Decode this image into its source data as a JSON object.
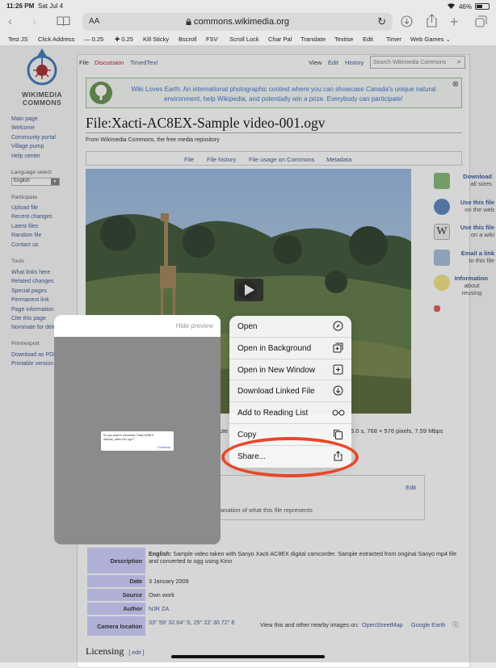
{
  "status": {
    "time": "11:26 PM",
    "date": "Sat Jul 4",
    "battery": "46%"
  },
  "browser": {
    "aa_label": "AA",
    "url": "commons.wikimedia.org",
    "bookmarks": [
      "Test JS",
      "Click Address",
      "— 0.25",
      "✚ 0.25",
      "Kill Sticky",
      "Bscroll",
      "FSV",
      "Scroll Lock",
      "Char Pal",
      "Translate",
      "Textise",
      "Edit",
      "Timer",
      "Web Games ⌄"
    ]
  },
  "wiki": {
    "logo_line1": "WIKIMEDIA",
    "logo_line2": "COMMONS",
    "nav": [
      "Main page",
      "Welcome",
      "Community portal",
      "Village pump",
      "Help center"
    ],
    "language_label": "Language select",
    "language_value": "English",
    "participate_head": "Participate",
    "participate": [
      "Upload file",
      "Recent changes",
      "Latest files",
      "Random file",
      "Contact us"
    ],
    "tools_head": "Tools",
    "tools": [
      "What links here",
      "Related changes",
      "Special pages",
      "Permanent link",
      "Page information",
      "Cite this page",
      "Nominate for dele"
    ],
    "print_head": "Print/export",
    "print": [
      "Download as PDF",
      "Printable version"
    ],
    "tabs": {
      "file": "File",
      "discussion": "Discussion",
      "timedtext": "TimedText",
      "view": "View",
      "edit": "Edit",
      "history": "History"
    },
    "search_placeholder": "Search Wikimedia Commons",
    "banner": "Wiki Loves Earth: An international photographic contest where you can showcase Canada's unique natural environment, help Wikipedia, and potentially win a prize. Everybody can participate!",
    "title": "File:Xacti-AC8EX-Sample video-001.ogv",
    "from": "From Wikimedia Commons, the free media repository",
    "file_tabs": [
      "File",
      "File history",
      "File usage on Commons",
      "Metadata"
    ],
    "right_links": [
      {
        "bold": "Download",
        "sub": "all sizes"
      },
      {
        "bold": "Use this file",
        "sub": "on the web"
      },
      {
        "bold": "Use this file",
        "sub": "on a wiki"
      },
      {
        "bold": "Email a link",
        "sub": "to this file"
      },
      {
        "bold": "Information",
        "sub": "about reusing"
      }
    ],
    "meta_fragment_left": "ple",
    "meta_fragment_right": "5.0 s, 768 × 576 pixels, 7.59 Mbps",
    "desc_edit": "Edit",
    "desc_text": "anation of what this file represents",
    "table": [
      {
        "key": "Description",
        "value_bold": "English:",
        "value": " Sample video taken with Sanyo Xacti AC8EX digital camcorder. Sample extracted from original Sanyo mp4 file and converted to ogg using Kino"
      },
      {
        "key": "Date",
        "value": "3 January 2009"
      },
      {
        "key": "Source",
        "value": "Own work"
      },
      {
        "key": "Author",
        "value": "NJR ZA"
      },
      {
        "key": "Camera location",
        "value": "33° 59′ 32.64″ S, 25° 22′ 30.72″ E",
        "extra": "View this and other nearby images on:",
        "link1": "OpenStreetMap",
        "link2": "Google Earth"
      }
    ],
    "licensing": "Licensing",
    "licensing_edit": "[ edit ]"
  },
  "preview": {
    "hide_label": "Hide preview",
    "dialog_text": "Do you want to download \"Xacti-AC8EX-Sample_video-001.ogv\"?",
    "dialog_button": "Download"
  },
  "menu": {
    "items": [
      {
        "label": "Open",
        "icon": "compass-icon"
      },
      {
        "label": "Open in Background",
        "icon": "open-background-icon"
      },
      {
        "label": "Open in New Window",
        "icon": "new-window-icon"
      },
      {
        "label": "Download Linked File",
        "icon": "download-icon"
      },
      {
        "label": "Add to Reading List",
        "icon": "glasses-icon"
      },
      {
        "label": "Copy",
        "icon": "copy-icon"
      },
      {
        "label": "Share...",
        "icon": "share-icon"
      }
    ]
  },
  "colors": {
    "link": "#2a4b8d",
    "annotation": "#e8472a",
    "table_key_bg": "#ccccff"
  }
}
